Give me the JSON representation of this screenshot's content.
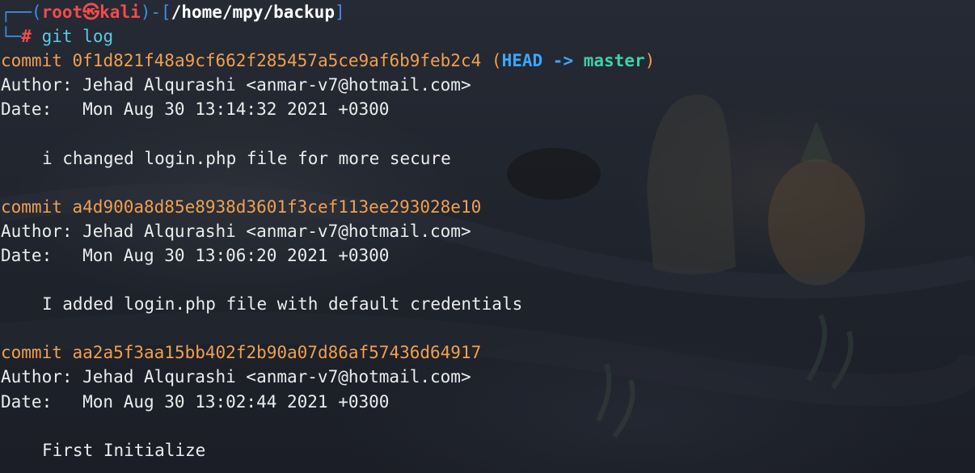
{
  "prompt": {
    "corner_top": "┌──(",
    "user": "root",
    "skull": "㉿",
    "host": "kali",
    "mid": ")-[",
    "path": "/home/mpy/backup",
    "end": "]",
    "corner_bottom": "└─",
    "hash": "#",
    "command": "git log"
  },
  "commits": [
    {
      "label": "commit",
      "hash": "0f1d821f48a9cf662f285457a5ce9af6b9feb2c4",
      "ref_open": "(",
      "ref_head": "HEAD",
      "ref_arrow": "->",
      "ref_branch": "master",
      "ref_close": ")",
      "author_line": "Author: Jehad Alqurashi <anmar-v7@hotmail.com>",
      "date_line": "Date:   Mon Aug 30 13:14:32 2021 +0300",
      "message": "i changed login.php file for more secure"
    },
    {
      "label": "commit",
      "hash": "a4d900a8d85e8938d3601f3cef113ee293028e10",
      "author_line": "Author: Jehad Alqurashi <anmar-v7@hotmail.com>",
      "date_line": "Date:   Mon Aug 30 13:06:20 2021 +0300",
      "message": "I added login.php file with default credentials"
    },
    {
      "label": "commit",
      "hash": "aa2a5f3aa15bb402f2b90a07d86af57436d64917",
      "author_line": "Author: Jehad Alqurashi <anmar-v7@hotmail.com>",
      "date_line": "Date:   Mon Aug 30 13:02:44 2021 +0300",
      "message": "First Initialize"
    }
  ],
  "colors": {
    "prompt_frame": "#3b8eea",
    "prompt_user": "#f14c4c",
    "commit_hash": "#f0a050",
    "head_ref": "#3ba7ff",
    "branch_ref": "#3fd0a8",
    "text": "#ececec",
    "background": "#212530"
  }
}
